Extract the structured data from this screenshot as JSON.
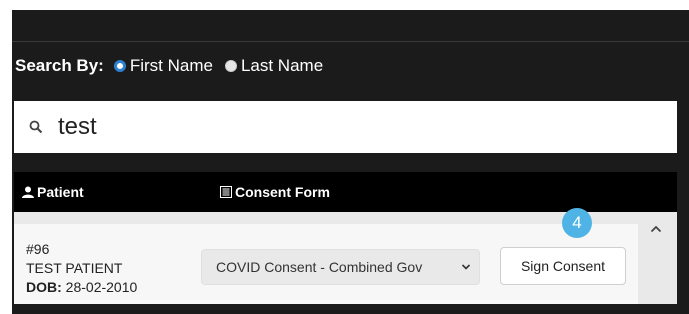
{
  "search": {
    "by_label": "Search By:",
    "options": [
      {
        "label": "First Name",
        "checked": true
      },
      {
        "label": "Last Name",
        "checked": false
      }
    ],
    "value": "test",
    "icon": "search-icon"
  },
  "table": {
    "columns": [
      {
        "label": "Patient",
        "icon": "user-icon"
      },
      {
        "label": "Consent Form",
        "icon": "list-icon"
      }
    ],
    "rows": [
      {
        "id": "#96",
        "name": "TEST PATIENT",
        "dob_label": "DOB:",
        "dob": "28-02-2010",
        "consent_selected": "COVID Consent - Combined Gov",
        "action_label": "Sign Consent"
      }
    ]
  },
  "annotation": {
    "step": "4",
    "color": "#4fb3e6"
  },
  "colors": {
    "background": "#1b1b1b",
    "header": "#000000",
    "radio_checked": "#2f7fd1"
  }
}
